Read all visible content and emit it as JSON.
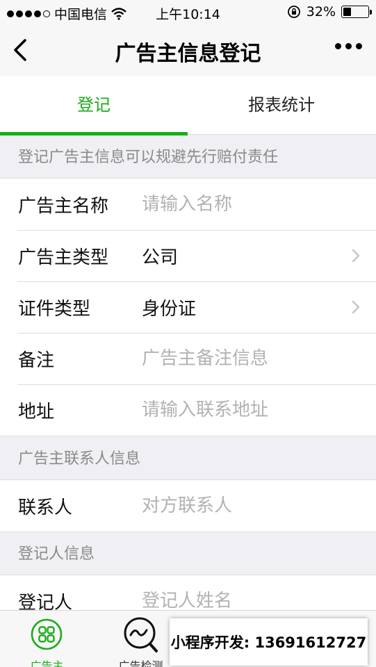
{
  "status_bar": {
    "carrier": "中国电信",
    "time": "上午10:14",
    "battery_text": "32%",
    "battery_level": 0.32,
    "icons": [
      "signal-dots-icon",
      "wifi-icon",
      "rotation-lock-icon",
      "battery-icon"
    ]
  },
  "nav": {
    "title": "广告主信息登记",
    "icons": [
      "back-chevron-icon",
      "more-dots-icon"
    ]
  },
  "tabs": [
    {
      "label": "登记",
      "active": true
    },
    {
      "label": "报表统计",
      "active": false
    }
  ],
  "sections": {
    "advertiser": {
      "header": "登记广告主信息可以规避先行赔付责任",
      "name": {
        "label": "广告主名称",
        "placeholder": "请输入名称",
        "value": ""
      },
      "type": {
        "label": "广告主类型",
        "value": "公司"
      },
      "id_type": {
        "label": "证件类型",
        "value": "身份证"
      },
      "remark": {
        "label": "备注",
        "placeholder": "广告主备注信息",
        "value": ""
      },
      "address": {
        "label": "地址",
        "placeholder": "请输入联系地址",
        "value": ""
      }
    },
    "contact": {
      "header": "广告主联系人信息",
      "contact": {
        "label": "联系人",
        "placeholder": "对方联系人",
        "value": ""
      }
    },
    "registrar": {
      "header": "登记人信息",
      "registrar": {
        "label": "登记人",
        "placeholder": "登记人姓名",
        "value": ""
      }
    }
  },
  "tabbar": {
    "items": [
      {
        "label": "广告主",
        "icon": "grid-circle-icon",
        "active": true
      },
      {
        "label": "广告检测",
        "icon": "search-wave-icon",
        "active": false
      }
    ]
  },
  "banner": {
    "text": "小程序开发: 13691612727"
  },
  "colors": {
    "accent": "#1aad19",
    "background": "#efeff4",
    "placeholder": "#b2b2b2",
    "section_text": "#8a8a8a"
  }
}
